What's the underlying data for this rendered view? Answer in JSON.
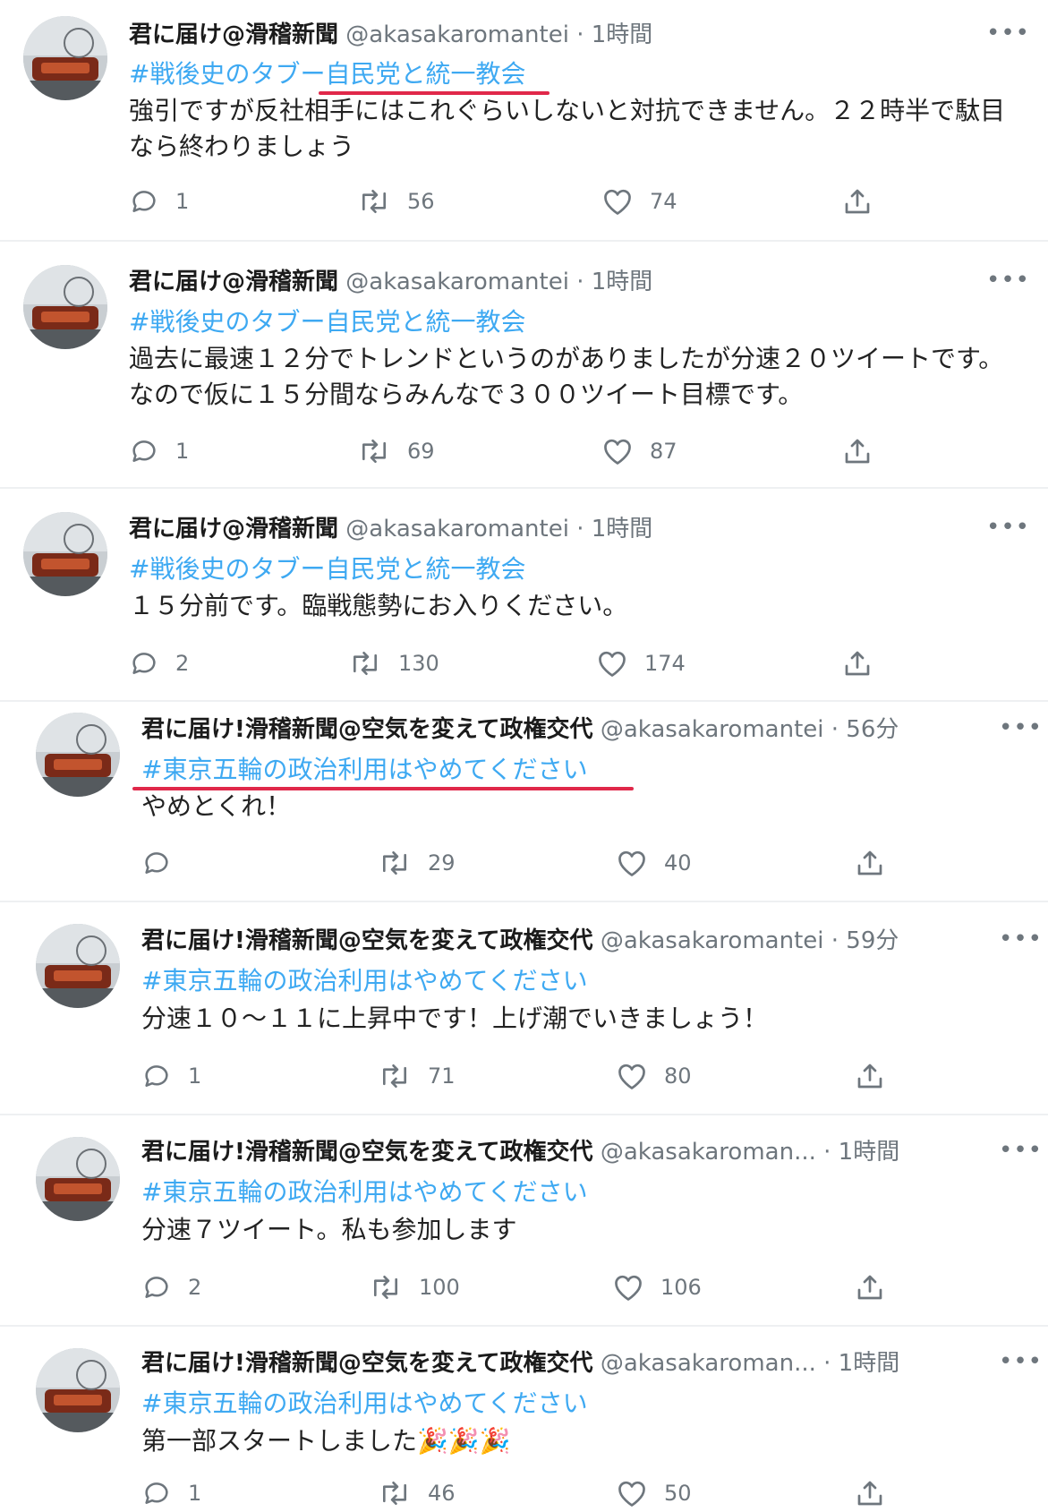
{
  "tweets": [
    {
      "name": "君に届け@滑稽新聞",
      "handle": "@akasakaromantei",
      "time": "· 1時間",
      "hashtag": "#戦後史のタブー自民党と統一教会",
      "text": "強引ですが反社相手にはこれぐらいしないと対抗できません。２２時半で駄目なら終わりましょう",
      "replies": "1",
      "retweets": "56",
      "likes": "74"
    },
    {
      "name": "君に届け@滑稽新聞",
      "handle": "@akasakaromantei",
      "time": "· 1時間",
      "hashtag": "#戦後史のタブー自民党と統一教会",
      "text": "過去に最速１２分でトレンドというのがありましたが分速２０ツイートです。なので仮に１５分間ならみんなで３００ツイート目標です。",
      "replies": "1",
      "retweets": "69",
      "likes": "87"
    },
    {
      "name": "君に届け@滑稽新聞",
      "handle": "@akasakaromantei",
      "time": "· 1時間",
      "hashtag": "#戦後史のタブー自民党と統一教会",
      "text": "１５分前です。臨戦態勢にお入りください。",
      "replies": "2",
      "retweets": "130",
      "likes": "174"
    },
    {
      "name": "君に届け!滑稽新聞@空気を変えて政権交代",
      "handle": "@akasakaromantei",
      "time": "· 56分",
      "hashtag": "#東京五輪の政治利用はやめてください",
      "text": "やめとくれ！",
      "replies": "",
      "retweets": "29",
      "likes": "40"
    },
    {
      "name": "君に届け!滑稽新聞@空気を変えて政権交代",
      "handle": "@akasakaromantei",
      "time": "· 59分",
      "hashtag": "#東京五輪の政治利用はやめてください",
      "text": "分速１０～１１に上昇中です！上げ潮でいきましょう！",
      "replies": "1",
      "retweets": "71",
      "likes": "80"
    },
    {
      "name": "君に届け!滑稽新聞@空気を変えて政権交代",
      "handle": "@akasakaroman...",
      "time": "· 1時間",
      "hashtag": "#東京五輪の政治利用はやめてください",
      "text": "分速７ツイート。私も参加します",
      "replies": "2",
      "retweets": "100",
      "likes": "106"
    },
    {
      "name": "君に届け!滑稽新聞@空気を変えて政権交代",
      "handle": "@akasakaroman...",
      "time": "· 1時間",
      "hashtag": "#東京五輪の政治利用はやめてください",
      "text": "第一部スタートしました🎉🎉🎉",
      "replies": "1",
      "retweets": "46",
      "likes": "50"
    }
  ],
  "more_label": "•••",
  "colors": {
    "hashtag": "#1d9bf0",
    "underline": "#e0284a",
    "muted": "#6e767d"
  },
  "icons": [
    "reply-icon",
    "retweet-icon",
    "like-icon",
    "share-icon"
  ]
}
